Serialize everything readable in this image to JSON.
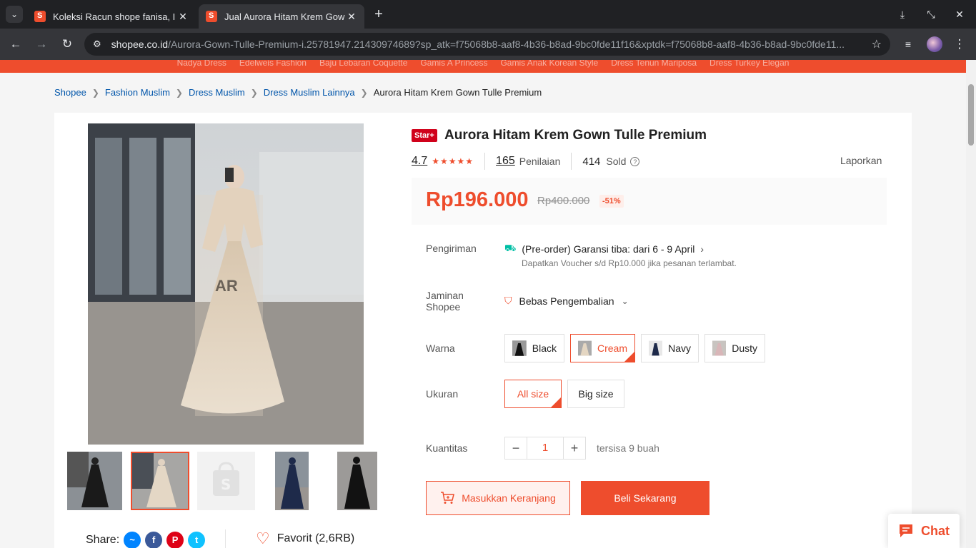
{
  "browser": {
    "tabs": [
      {
        "title": "Koleksi Racun shope fanisa, I",
        "active": false
      },
      {
        "title": "Jual Aurora Hitam Krem Gow",
        "active": true
      }
    ],
    "url_host": "shopee.co.id",
    "url_path": "/Aurora-Gown-Tulle-Premium-i.25781947.21430974689?sp_atk=f75068b8-aaf8-4b36-b8ad-9bc0fde11f16&xptdk=f75068b8-aaf8-4b36-b8ad-9bc0fde11...",
    "icons": {
      "dropdown": "chevron-down-icon",
      "new_tab": "plus-icon",
      "download": "download-icon",
      "minimize": "collapse-icon",
      "close": "close-icon",
      "back": "back-arrow-icon",
      "forward": "forward-arrow-icon",
      "reload": "reload-icon",
      "site_settings": "tune-icon",
      "bookmark": "star-icon",
      "media": "media-control-icon",
      "menu": "kebab-menu-icon"
    }
  },
  "top_links": [
    "Nadya Dress",
    "Edelweis Fashion",
    "Baju Lebaran Coquette",
    "Gamis A Princess",
    "Gamis Anak Korean Style",
    "Dress Tenun Mariposa",
    "Dress Turkey Elegan"
  ],
  "breadcrumb": [
    "Shopee",
    "Fashion Muslim",
    "Dress Muslim",
    "Dress Muslim Lainnya",
    "Aurora Hitam Krem Gown Tulle Premium"
  ],
  "product": {
    "badge": "Star+",
    "title": "Aurora Hitam Krem Gown Tulle Premium",
    "rating": "4.7",
    "stars": 5,
    "reviews_count": "165",
    "reviews_label": "Penilaian",
    "sold_count": "414",
    "sold_label": "Sold",
    "report_label": "Laporkan",
    "price": "Rp196.000",
    "old_price": "Rp400.000",
    "discount": "-51%",
    "watermark": "AR"
  },
  "shipping": {
    "label": "Pengiriman",
    "main": "(Pre-order) Garansi tiba: dari 6 - 9 April",
    "sub": "Dapatkan Voucher s/d Rp10.000 jika pesanan terlambat."
  },
  "guarantee": {
    "label": "Jaminan Shopee",
    "value": "Bebas Pengembalian"
  },
  "colors": {
    "label": "Warna",
    "options": [
      "Black",
      "Cream",
      "Navy",
      "Dusty"
    ],
    "selected": "Cream"
  },
  "sizes": {
    "label": "Ukuran",
    "options": [
      "All size",
      "Big size"
    ],
    "selected": "All size"
  },
  "quantity": {
    "label": "Kuantitas",
    "value": "1",
    "minus": "−",
    "plus": "+",
    "stock": "tersisa 9 buah"
  },
  "actions": {
    "add_to_cart": "Masukkan Keranjang",
    "buy_now": "Beli Sekarang"
  },
  "share": {
    "label": "Share:",
    "icons": [
      "messenger-icon",
      "facebook-icon",
      "pinterest-icon",
      "twitter-icon"
    ]
  },
  "favorite": {
    "label": "Favorit (2,6RB)"
  },
  "chat": {
    "label": "Chat"
  },
  "theme": {
    "accent": "#ee4d2d",
    "link": "#0055aa"
  }
}
